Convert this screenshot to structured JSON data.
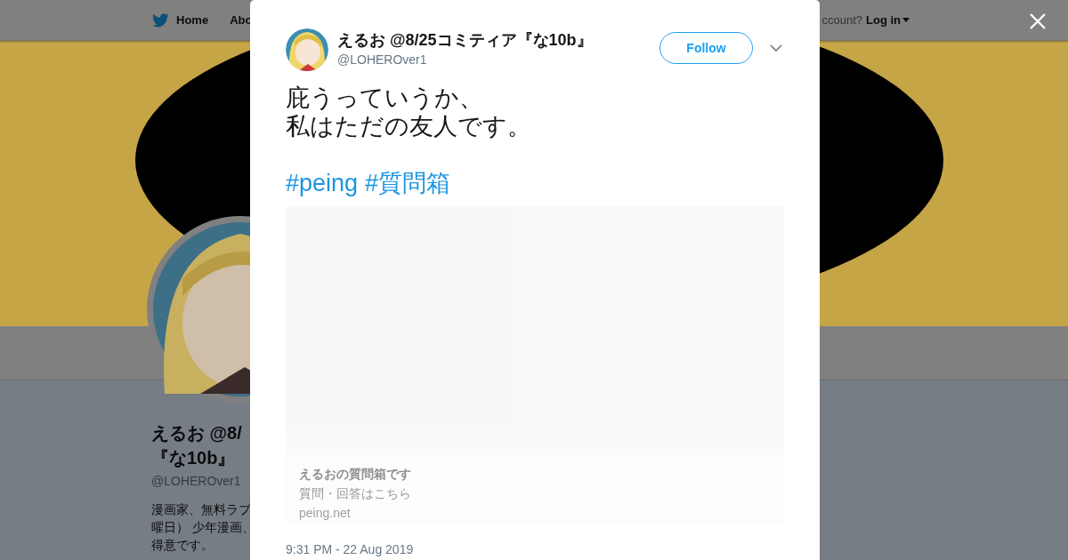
{
  "background_page": {
    "nav": {
      "items": [
        {
          "label": "Home"
        },
        {
          "label": "Abo"
        }
      ],
      "login_prompt": "ccount?",
      "login": "Log in"
    },
    "profile": {
      "name_lines": [
        "えるお @8/",
        "『な10b』"
      ],
      "handle": "@LOHEROver1",
      "bio_lines": [
        "漫画家、無料ラブ",
        "曜日） 少年漫画、",
        "得意です。"
      ]
    }
  },
  "tweet": {
    "author": {
      "name": "えるお @8/25コミティア『な10b』",
      "handle": "@LOHEROver1"
    },
    "follow_button": "Follow",
    "text_lines": [
      "庇うっていうか、",
      "私はただの友人です。"
    ],
    "hashtags": [
      "#peing",
      "#質問箱"
    ],
    "card": {
      "title": "えるおの質問箱です",
      "description": "質問・回答はこちら",
      "domain": "peing.net"
    },
    "timestamp": "9:31 PM - 22 Aug 2019"
  }
}
